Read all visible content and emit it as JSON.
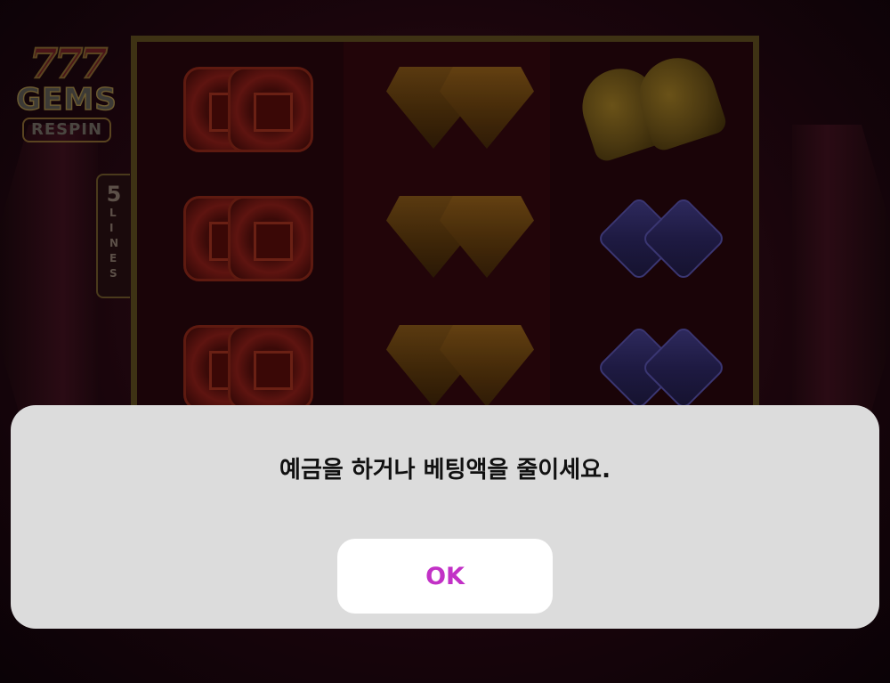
{
  "game": {
    "logo": {
      "numbers": "777",
      "title": "GEMS",
      "subtitle": "RESPIN"
    },
    "lines_tab": {
      "number": "5",
      "word": "LINES"
    },
    "reels": [
      {
        "symbols": [
          "red-gem",
          "red-gem",
          "red-gem"
        ]
      },
      {
        "symbols": [
          "gold-gem",
          "gold-gem",
          "gold-gem"
        ]
      },
      {
        "symbols": [
          "bell",
          "purple-gem",
          "purple-gem"
        ]
      }
    ]
  },
  "dialog": {
    "message": "예금을 하거나 베팅액을 줄이세요.",
    "ok_label": "OK",
    "ok_color": "#c231c6"
  }
}
